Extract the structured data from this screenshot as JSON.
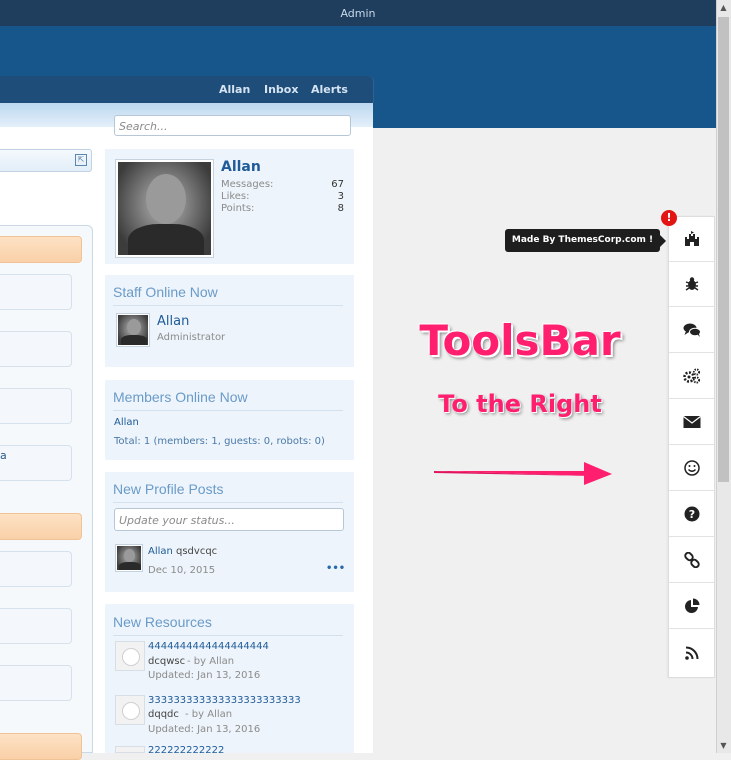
{
  "topbar": {
    "title": "Admin"
  },
  "nav": {
    "items": [
      "Allan",
      "Inbox",
      "Alerts"
    ]
  },
  "search": {
    "placeholder": "Search..."
  },
  "profile": {
    "name": "Allan",
    "stats": [
      {
        "label": "Messages:",
        "value": "67"
      },
      {
        "label": "Likes:",
        "value": "3"
      },
      {
        "label": "Points:",
        "value": "8"
      }
    ]
  },
  "staff_online": {
    "title": "Staff Online Now",
    "member": {
      "name": "Allan",
      "role": "Administrator"
    }
  },
  "members_online": {
    "title": "Members Online Now",
    "member": "Allan",
    "total": "Total: 1 (members: 1, guests: 0, robots: 0)"
  },
  "profile_posts": {
    "title": "New Profile Posts",
    "placeholder": "Update your status...",
    "post": {
      "author": "Allan",
      "text": "qsdvcqc",
      "date": "Dec 10, 2015",
      "more": "•••"
    }
  },
  "resources": {
    "title": "New Resources",
    "items": [
      {
        "name": "4444444444444444444",
        "desc": "dcqwsc",
        "by": "- by Allan",
        "updated": "Updated: Jan 13, 2016"
      },
      {
        "name": "333333333333333333333333",
        "desc": "dqqdc",
        "by": "- by Allan",
        "updated": "Updated: Jan 13, 2016"
      },
      {
        "name": "222222222222"
      }
    ]
  },
  "left": {
    "char": "a"
  },
  "overlay": {
    "title": "ToolsBar",
    "subtitle": "To the Right"
  },
  "toolbar": {
    "tooltip": "Made By ThemesCorp.com !",
    "badge": "!",
    "tools": [
      "castle-icon",
      "bug-icon",
      "comments-icon",
      "cogs-icon",
      "envelope-icon",
      "smile-icon",
      "question-icon",
      "link-icon",
      "pie-chart-icon",
      "rss-icon"
    ]
  },
  "colors": {
    "accent": "#ff1f6e",
    "banner": "#17568a",
    "topbar": "#1f3e5e",
    "link": "#1f5b99"
  }
}
